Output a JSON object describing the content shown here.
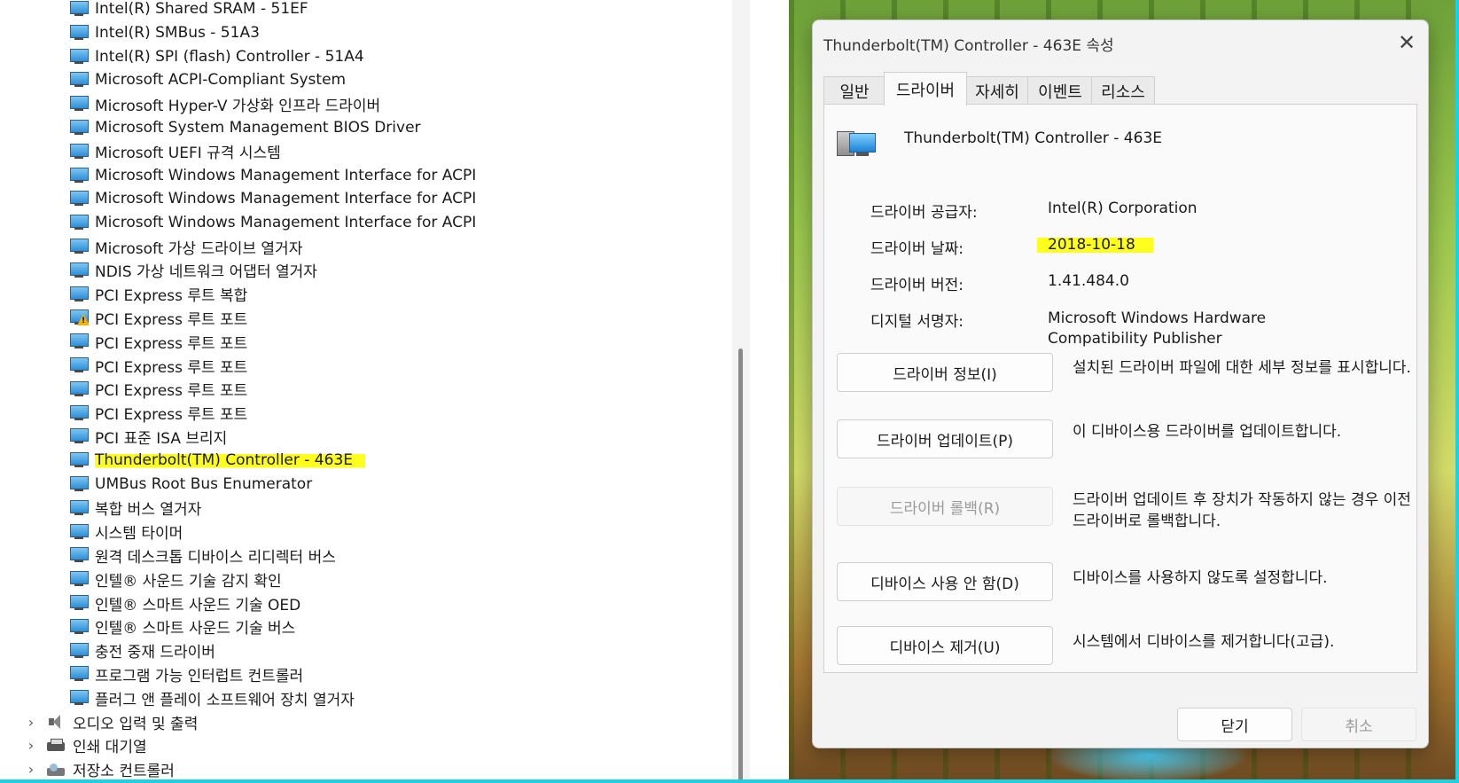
{
  "device_tree": {
    "devices": [
      {
        "label": "Intel(R) Shared SRAM - 51EF",
        "warning": false
      },
      {
        "label": "Intel(R) SMBus - 51A3",
        "warning": false
      },
      {
        "label": "Intel(R) SPI (flash) Controller - 51A4",
        "warning": false
      },
      {
        "label": "Microsoft ACPI-Compliant System",
        "warning": false
      },
      {
        "label": "Microsoft Hyper-V 가상화 인프라 드라이버",
        "warning": false
      },
      {
        "label": "Microsoft System Management BIOS Driver",
        "warning": false
      },
      {
        "label": "Microsoft UEFI 규격 시스템",
        "warning": false
      },
      {
        "label": "Microsoft Windows Management Interface for ACPI",
        "warning": false
      },
      {
        "label": "Microsoft Windows Management Interface for ACPI",
        "warning": false
      },
      {
        "label": "Microsoft Windows Management Interface for ACPI",
        "warning": false
      },
      {
        "label": "Microsoft 가상 드라이브 열거자",
        "warning": false
      },
      {
        "label": "NDIS 가상 네트워크 어댑터 열거자",
        "warning": false
      },
      {
        "label": "PCI Express 루트 복합",
        "warning": false
      },
      {
        "label": "PCI Express 루트 포트",
        "warning": true
      },
      {
        "label": "PCI Express 루트 포트",
        "warning": false
      },
      {
        "label": "PCI Express 루트 포트",
        "warning": false
      },
      {
        "label": "PCI Express 루트 포트",
        "warning": false
      },
      {
        "label": "PCI Express 루트 포트",
        "warning": false
      },
      {
        "label": "PCI 표준 ISA 브리지",
        "warning": false
      },
      {
        "label": "Thunderbolt(TM) Controller - 463E",
        "warning": false,
        "highlighted": true
      },
      {
        "label": "UMBus Root Bus Enumerator",
        "warning": false
      },
      {
        "label": "복합 버스 열거자",
        "warning": false
      },
      {
        "label": "시스템 타이머",
        "warning": false
      },
      {
        "label": "원격 데스크톱 디바이스 리디렉터 버스",
        "warning": false
      },
      {
        "label": "인텔® 사운드 기술 감지 확인",
        "warning": false
      },
      {
        "label": "인텔® 스마트 사운드 기술 OED",
        "warning": false
      },
      {
        "label": "인텔® 스마트 사운드 기술 버스",
        "warning": false
      },
      {
        "label": "충전 중재 드라이버",
        "warning": false
      },
      {
        "label": "프로그램 가능 인터럽트 컨트롤러",
        "warning": false
      },
      {
        "label": "플러그 앤 플레이 소프트웨어 장치 열거자",
        "warning": false
      }
    ],
    "categories": [
      {
        "label": "오디오 입력 및 출력",
        "icon": "speaker-icon",
        "expand_glyph": "›"
      },
      {
        "label": "인쇄 대기열",
        "icon": "printer-icon",
        "expand_glyph": "›"
      },
      {
        "label": "저장소 컨트롤러",
        "icon": "storage-icon",
        "expand_glyph": "›"
      }
    ]
  },
  "dialog": {
    "title": "Thunderbolt(TM) Controller - 463E 속성",
    "close_glyph": "✕",
    "tabs": [
      "일반",
      "드라이버",
      "자세히",
      "이벤트",
      "리소스"
    ],
    "active_tab": "드라이버",
    "device_name": "Thunderbolt(TM) Controller - 463E",
    "fields": {
      "provider_label": "드라이버 공급자:",
      "provider_value": "Intel(R) Corporation",
      "date_label": "드라이버 날짜:",
      "date_value": "2018-10-18",
      "version_label": "드라이버 버전:",
      "version_value": "1.41.484.0",
      "signer_label": "디지털 서명자:",
      "signer_value": "Microsoft Windows Hardware Compatibility Publisher"
    },
    "actions": {
      "details_label": "드라이버 정보(I)",
      "details_desc": "설치된 드라이버 파일에 대한 세부 정보를 표시합니다.",
      "update_label": "드라이버 업데이트(P)",
      "update_desc": "이 디바이스용 드라이버를 업데이트합니다.",
      "rollback_label": "드라이버 롤백(R)",
      "rollback_desc": "드라이버 업데이트 후 장치가 작동하지 않는 경우 이전 드라이버로 롤백합니다.",
      "disable_label": "디바이스 사용 안 함(D)",
      "disable_desc": "디바이스를 사용하지 않도록 설정합니다.",
      "uninstall_label": "디바이스 제거(U)",
      "uninstall_desc": "시스템에서 디바이스를 제거합니다(고급)."
    },
    "footer": {
      "close_label": "닫기",
      "cancel_label": "취소"
    }
  },
  "colors": {
    "highlight": "#ffff1e",
    "dialog_bg": "#f3f3f3",
    "screen_border": "#20d0e0"
  }
}
